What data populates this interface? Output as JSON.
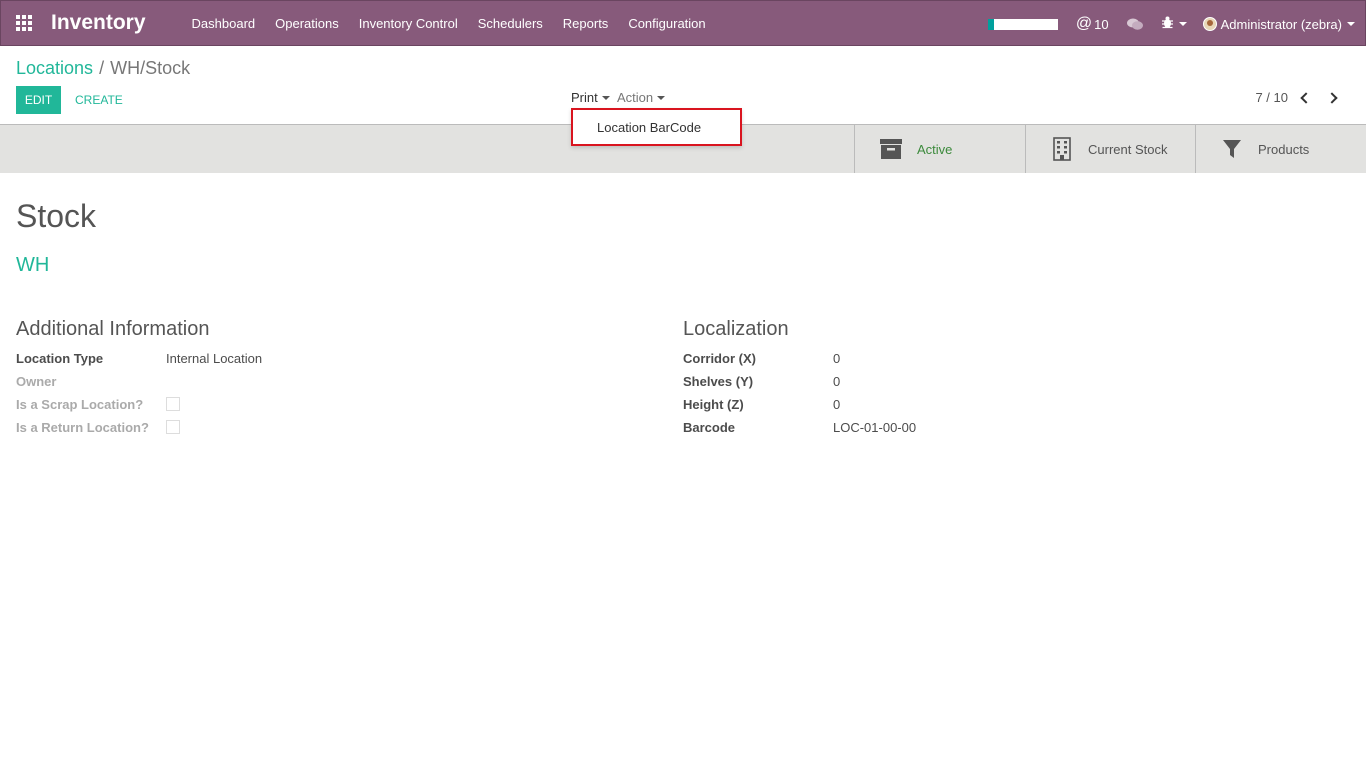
{
  "navbar": {
    "brand": "Inventory",
    "menu": [
      "Dashboard",
      "Operations",
      "Inventory Control",
      "Schedulers",
      "Reports",
      "Configuration"
    ],
    "progress_fraction": 0.08,
    "mention_count": "10",
    "user": "Administrator (zebra)",
    "icons": [
      "apps-grid-icon",
      "at-icon",
      "chat-icon",
      "bug-icon"
    ],
    "bg_color": "#875a7b"
  },
  "breadcrumb": {
    "parent": "Locations",
    "separator": "/",
    "current": "WH/Stock"
  },
  "controls": {
    "edit": "EDIT",
    "create": "CREATE",
    "print": "Print",
    "action": "Action",
    "pager": "7 / 10"
  },
  "print_menu": {
    "items": [
      "Location BarCode"
    ]
  },
  "smart_buttons": [
    {
      "label": "Active",
      "icon": "archive-icon"
    },
    {
      "label": "Current Stock",
      "icon": "building-icon"
    },
    {
      "label": "Products",
      "icon": "filter-icon"
    }
  ],
  "record": {
    "name": "Stock",
    "parent": "WH"
  },
  "additional_info": {
    "title": "Additional Information",
    "location_type_label": "Location Type",
    "location_type_value": "Internal Location",
    "owner_label": "Owner",
    "scrap_label": "Is a Scrap Location?",
    "return_label": "Is a Return Location?"
  },
  "localization": {
    "title": "Localization",
    "corridor_label": "Corridor (X)",
    "corridor_value": "0",
    "shelves_label": "Shelves (Y)",
    "shelves_value": "0",
    "height_label": "Height (Z)",
    "height_value": "0",
    "barcode_label": "Barcode",
    "barcode_value": "LOC-01-00-00"
  },
  "colors": {
    "accent": "#21b799",
    "highlight_border": "#d9141f",
    "active_green": "#3c8a3c"
  }
}
